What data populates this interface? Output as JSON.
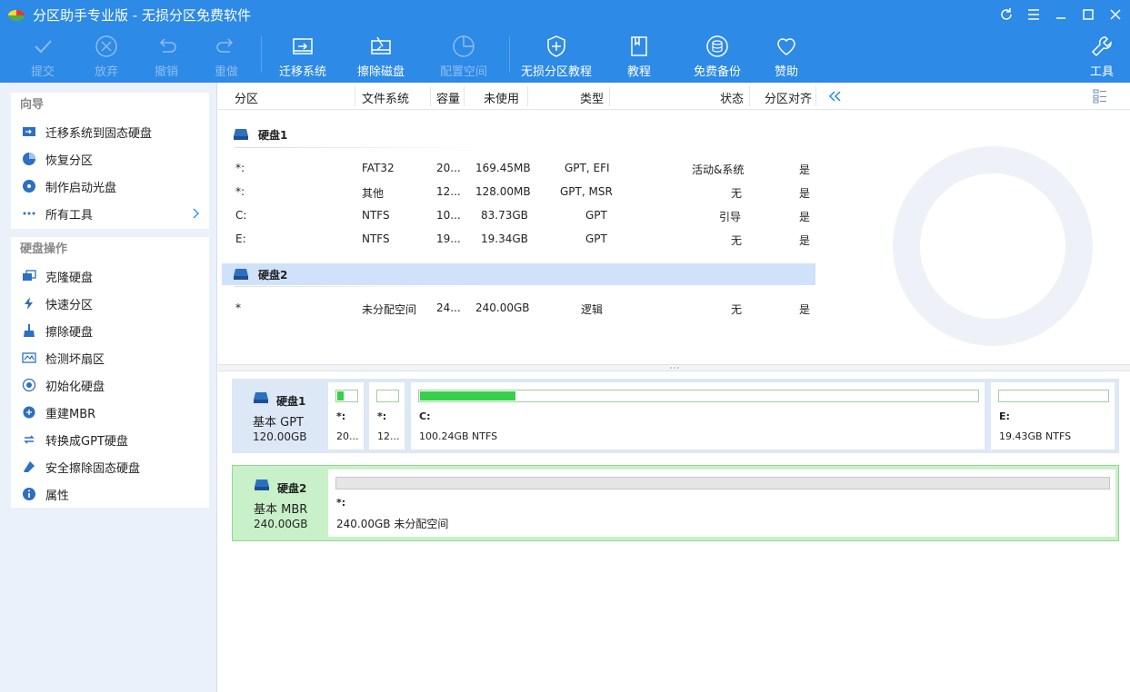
{
  "app": {
    "title": "分区助手专业版 - 无损分区免费软件"
  },
  "toolbar": {
    "submit": "提交",
    "discard": "放弃",
    "undo": "撤销",
    "redo": "重做",
    "migrate": "迁移系统",
    "wipe": "擦除磁盘",
    "allocate": "配置空间",
    "tutorial_lossless": "无损分区教程",
    "tutorial": "教程",
    "backup": "免费备份",
    "sponsor": "赞助",
    "tools": "工具"
  },
  "sidebar": {
    "wizard_title": "向导",
    "wizard_items": [
      "迁移系统到固态硬盘",
      "恢复分区",
      "制作启动光盘",
      "所有工具"
    ],
    "disk_ops_title": "硬盘操作",
    "disk_ops_items": [
      "克隆硬盘",
      "快速分区",
      "擦除硬盘",
      "检测坏扇区",
      "初始化硬盘",
      "重建MBR",
      "转换成GPT硬盘",
      "安全擦除固态硬盘",
      "属性"
    ]
  },
  "table": {
    "headers": {
      "partition": "分区",
      "fs": "文件系统",
      "capacity": "容量",
      "free": "未使用",
      "type": "类型",
      "status": "状态",
      "align": "分区对齐"
    },
    "disk1": {
      "name": "硬盘1",
      "rows": [
        {
          "part": "*:",
          "fs": "FAT32",
          "cap": "20...",
          "free": "169.45MB",
          "type": "GPT, EFI",
          "status": "活动&系统",
          "align": "是"
        },
        {
          "part": "*:",
          "fs": "其他",
          "cap": "12...",
          "free": "128.00MB",
          "type": "GPT, MSR",
          "status": "无",
          "align": "是"
        },
        {
          "part": "C:",
          "fs": "NTFS",
          "cap": "10...",
          "free": "83.73GB",
          "type": "GPT",
          "status": "引导",
          "align": "是"
        },
        {
          "part": "E:",
          "fs": "NTFS",
          "cap": "19...",
          "free": "19.34GB",
          "type": "GPT",
          "status": "无",
          "align": "是"
        }
      ]
    },
    "disk2": {
      "name": "硬盘2",
      "rows": [
        {
          "part": "*",
          "fs": "未分配空间",
          "cap": "24...",
          "free": "240.00GB",
          "type": "逻辑",
          "status": "无",
          "align": "是"
        }
      ]
    }
  },
  "diskmap": {
    "disk1": {
      "name": "硬盘1",
      "type": "基本 GPT",
      "size": "120.00GB",
      "parts": [
        {
          "name": "*:",
          "desc": "20...",
          "used": 0.3
        },
        {
          "name": "*:",
          "desc": "12...",
          "used": 0
        },
        {
          "name": "C:",
          "desc": "100.24GB NTFS",
          "used": 0.17
        },
        {
          "name": "E:",
          "desc": "19.43GB NTFS",
          "used": 0
        }
      ]
    },
    "disk2": {
      "name": "硬盘2",
      "type": "基本 MBR",
      "size": "240.00GB",
      "parts": [
        {
          "name": "*:",
          "desc": "240.00GB 未分配空间"
        }
      ]
    }
  },
  "colors": {
    "accent": "#2d8ae6",
    "used_fill": "#37d04b",
    "selected_row": "#cfe2fa",
    "disk2_bg": "#c9f1c9"
  }
}
